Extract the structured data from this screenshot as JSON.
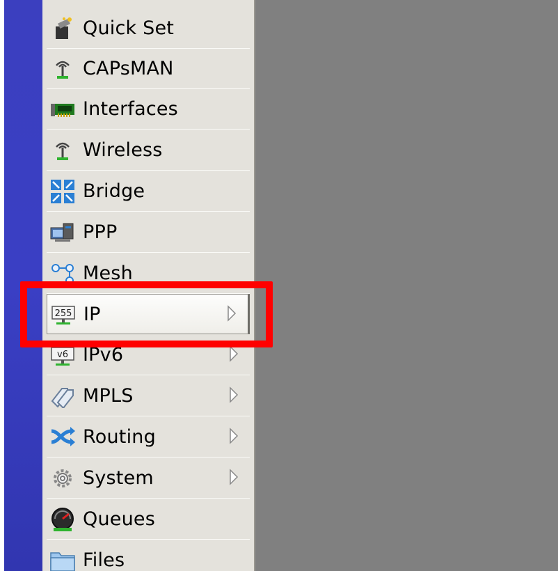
{
  "menu": {
    "items": [
      {
        "label": "Quick Set",
        "icon": "quick-set-wand-icon",
        "has_submenu": false
      },
      {
        "label": "CAPsMAN",
        "icon": "antenna-icon",
        "has_submenu": false
      },
      {
        "label": "Interfaces",
        "icon": "network-card-icon",
        "has_submenu": false
      },
      {
        "label": "Wireless",
        "icon": "antenna-icon",
        "has_submenu": false
      },
      {
        "label": "Bridge",
        "icon": "bridge-arrows-icon",
        "has_submenu": false
      },
      {
        "label": "PPP",
        "icon": "ppp-computers-icon",
        "has_submenu": false
      },
      {
        "label": "Mesh",
        "icon": "mesh-nodes-icon",
        "has_submenu": false
      },
      {
        "label": "IP",
        "icon": "ip-255-icon",
        "icon_text": "255",
        "has_submenu": true,
        "selected": true
      },
      {
        "label": "IPv6",
        "icon": "ipv6-icon",
        "icon_text": "v6",
        "has_submenu": true
      },
      {
        "label": "MPLS",
        "icon": "mpls-tags-icon",
        "has_submenu": true
      },
      {
        "label": "Routing",
        "icon": "routing-arrows-icon",
        "has_submenu": true
      },
      {
        "label": "System",
        "icon": "system-gear-icon",
        "has_submenu": true
      },
      {
        "label": "Queues",
        "icon": "queues-gauge-icon",
        "has_submenu": false
      },
      {
        "label": "Files",
        "icon": "folder-icon",
        "has_submenu": false
      }
    ]
  },
  "annotation": {
    "highlight_color": "#ff0000",
    "highlighted_item": "IP"
  },
  "colors": {
    "left_stripe": "#3a3fc4",
    "menu_background": "#e4e2dc",
    "workspace": "#808080"
  }
}
